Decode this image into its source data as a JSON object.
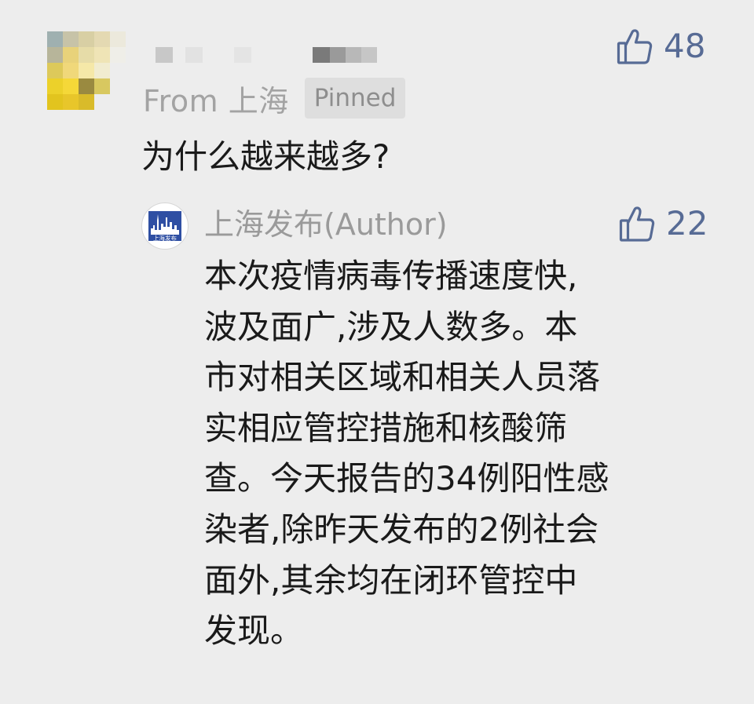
{
  "comment": {
    "author_name_blurred": true,
    "location": "From 上海",
    "badge": "Pinned",
    "likes": "48",
    "text": "为什么越来越多?"
  },
  "reply": {
    "author": "上海发布(Author)",
    "avatar_logo_text": "上海发布",
    "likes": "22",
    "text_lines": [
      "本次疫情病毒传播速度快,",
      "波及面广,涉及人数多。本",
      "市对相关区域和相关人员落",
      "实相应管控措施和核酸筛",
      "查。今天报告的34例阳性感",
      "染者,除昨天发布的2例社会",
      "面外,其余均在闭环管控中",
      "发现。"
    ]
  },
  "icons": {
    "like": "thumbs-up-outline-icon"
  },
  "colors": {
    "background": "#ededed",
    "link_blue": "#576b95",
    "muted_text": "#a3a3a3",
    "badge_bg": "#dedede",
    "logo_blue": "#2f4fa3"
  }
}
